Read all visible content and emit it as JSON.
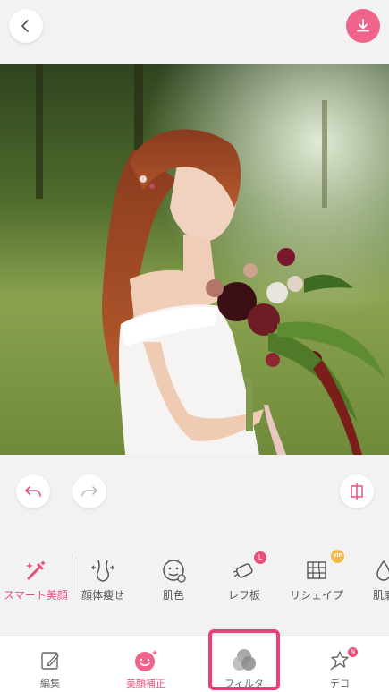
{
  "header": {
    "back_icon": "chevron-left-icon",
    "download_icon": "download-icon",
    "accent_color": "#f0648c"
  },
  "photo": {
    "subject": "bride-with-bouquet"
  },
  "edit_controls": {
    "undo_icon": "undo-icon",
    "redo_icon": "redo-icon",
    "compare_icon": "compare-icon"
  },
  "tools": [
    {
      "label": "スマート美顔",
      "icon": "magic-wand-icon",
      "active": true
    },
    {
      "label": "顔体痩せ",
      "icon": "body-slim-icon",
      "active": false
    },
    {
      "label": "肌色",
      "icon": "face-icon",
      "active": false
    },
    {
      "label": "レフ板",
      "icon": "reflector-icon",
      "active": false,
      "badge": "L"
    },
    {
      "label": "リシェイプ",
      "icon": "reshape-grid-icon",
      "active": false,
      "badge": "VIP"
    },
    {
      "label": "肌磨",
      "icon": "skin-icon",
      "active": false
    }
  ],
  "bottom_nav": [
    {
      "label": "編集",
      "icon": "edit-icon",
      "active": false
    },
    {
      "label": "美顔補正",
      "icon": "beauty-face-icon",
      "active": true
    },
    {
      "label": "フィルタ",
      "icon": "filter-icon",
      "active": false,
      "highlighted": true
    },
    {
      "label": "デコ",
      "icon": "sticker-icon",
      "active": false,
      "badge": "N"
    }
  ],
  "colors": {
    "accent": "#e8507a",
    "background": "#f2f2f2",
    "highlight_border": "#e8407a"
  }
}
